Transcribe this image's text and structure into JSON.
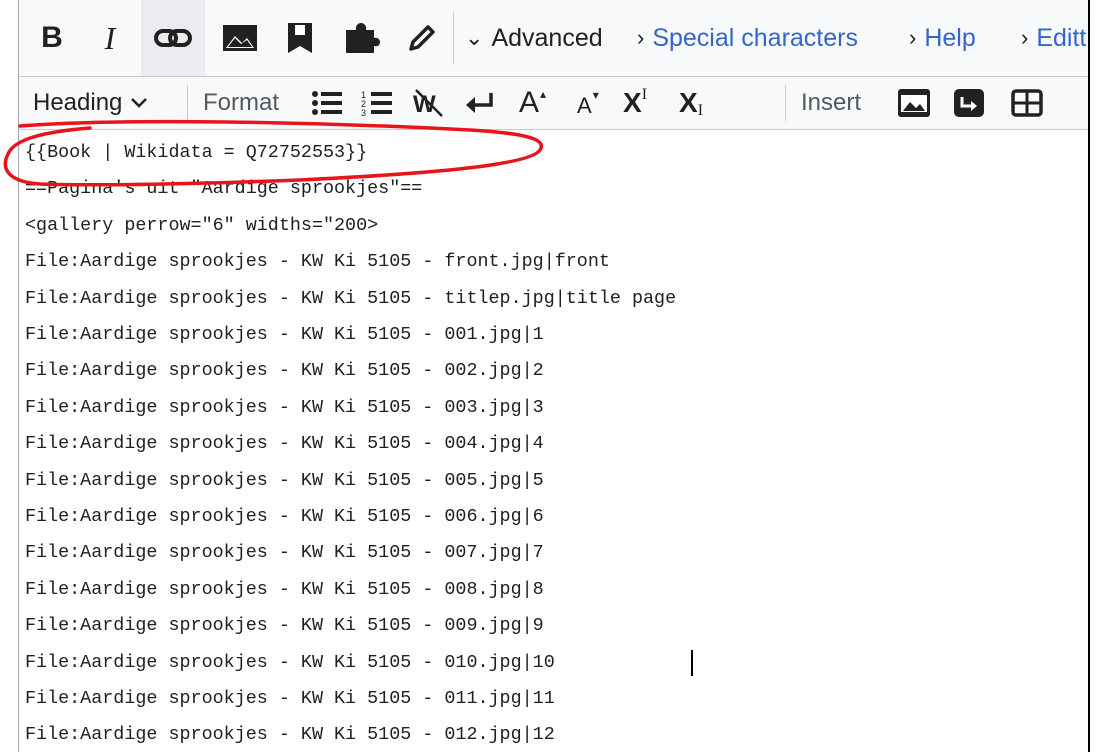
{
  "toolbar1": {
    "bold_label": "B",
    "italic_label": "I",
    "icons": [
      "link-icon",
      "image-icon",
      "reference-icon",
      "puzzle-icon",
      "pencil-icon"
    ],
    "advanced_label": "Advanced",
    "special_characters_label": "Special characters",
    "help_label": "Help",
    "editing_label": "Editt"
  },
  "toolbar2": {
    "heading_label": "Heading",
    "format_label": "Format",
    "insert_label": "Insert",
    "superscript_base": "X",
    "superscript_mark": "I",
    "subscript_base": "X",
    "subscript_mark": "I",
    "big_a": "A",
    "small_a": "A",
    "icons": [
      "bulleted-list-icon",
      "numbered-list-icon",
      "nowiki-icon",
      "newline-icon",
      "big-text-icon",
      "small-text-icon",
      "superscript-icon",
      "subscript-icon",
      "gallery-icon",
      "redirect-icon",
      "table-icon"
    ]
  },
  "editor": {
    "lines": [
      "{{Book | Wikidata = Q72752553}}",
      "==Pagina's uit \"Aardige sprookjes\"==",
      "<gallery perrow=\"6\" widths=\"200>",
      "File:Aardige sprookjes - KW Ki 5105 - front.jpg|front",
      "File:Aardige sprookjes - KW Ki 5105 - titlep.jpg|title page",
      "File:Aardige sprookjes - KW Ki 5105 - 001.jpg|1",
      "File:Aardige sprookjes - KW Ki 5105 - 002.jpg|2",
      "File:Aardige sprookjes - KW Ki 5105 - 003.jpg|3",
      "File:Aardige sprookjes - KW Ki 5105 - 004.jpg|4",
      "File:Aardige sprookjes - KW Ki 5105 - 005.jpg|5",
      "File:Aardige sprookjes - KW Ki 5105 - 006.jpg|6",
      "File:Aardige sprookjes - KW Ki 5105 - 007.jpg|7",
      "File:Aardige sprookjes - KW Ki 5105 - 008.jpg|8",
      "File:Aardige sprookjes - KW Ki 5105 - 009.jpg|9",
      "File:Aardige sprookjes - KW Ki 5105 - 010.jpg|10",
      "File:Aardige sprookjes - KW Ki 5105 - 011.jpg|11",
      "File:Aardige sprookjes - KW Ki 5105 - 012.jpg|12"
    ]
  },
  "annotation": {
    "color": "#e8141c",
    "kind": "hand-drawn-ellipse"
  },
  "colors": {
    "link_blue": "#3366cc",
    "toolbar_bg": "#f8f9fa",
    "text": "#202122"
  }
}
